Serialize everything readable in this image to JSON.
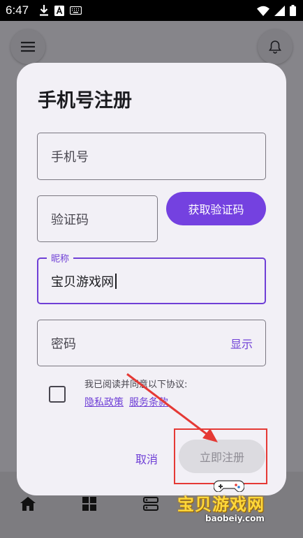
{
  "status_bar": {
    "time": "6:47",
    "icons": [
      "download-icon",
      "font-a-icon",
      "keyboard-icon",
      "wifi-icon",
      "signal-icon",
      "battery-icon"
    ]
  },
  "dialog": {
    "title": "手机号注册",
    "phone_placeholder": "手机号",
    "code_placeholder": "验证码",
    "get_code_label": "获取验证码",
    "nickname_label": "昵称",
    "nickname_value": "宝贝游戏网",
    "password_placeholder": "密码",
    "show_password_label": "显示",
    "agreement_text": "我已阅读并同意以下协议:",
    "privacy_link": "隐私政策",
    "terms_link": "服务条款",
    "cancel_label": "取消",
    "submit_label": "立即注册"
  },
  "watermark": {
    "title": "宝贝游戏网",
    "url": "baobeiy.com"
  },
  "colors": {
    "accent": "#7441e0",
    "annotation": "#e53935"
  }
}
